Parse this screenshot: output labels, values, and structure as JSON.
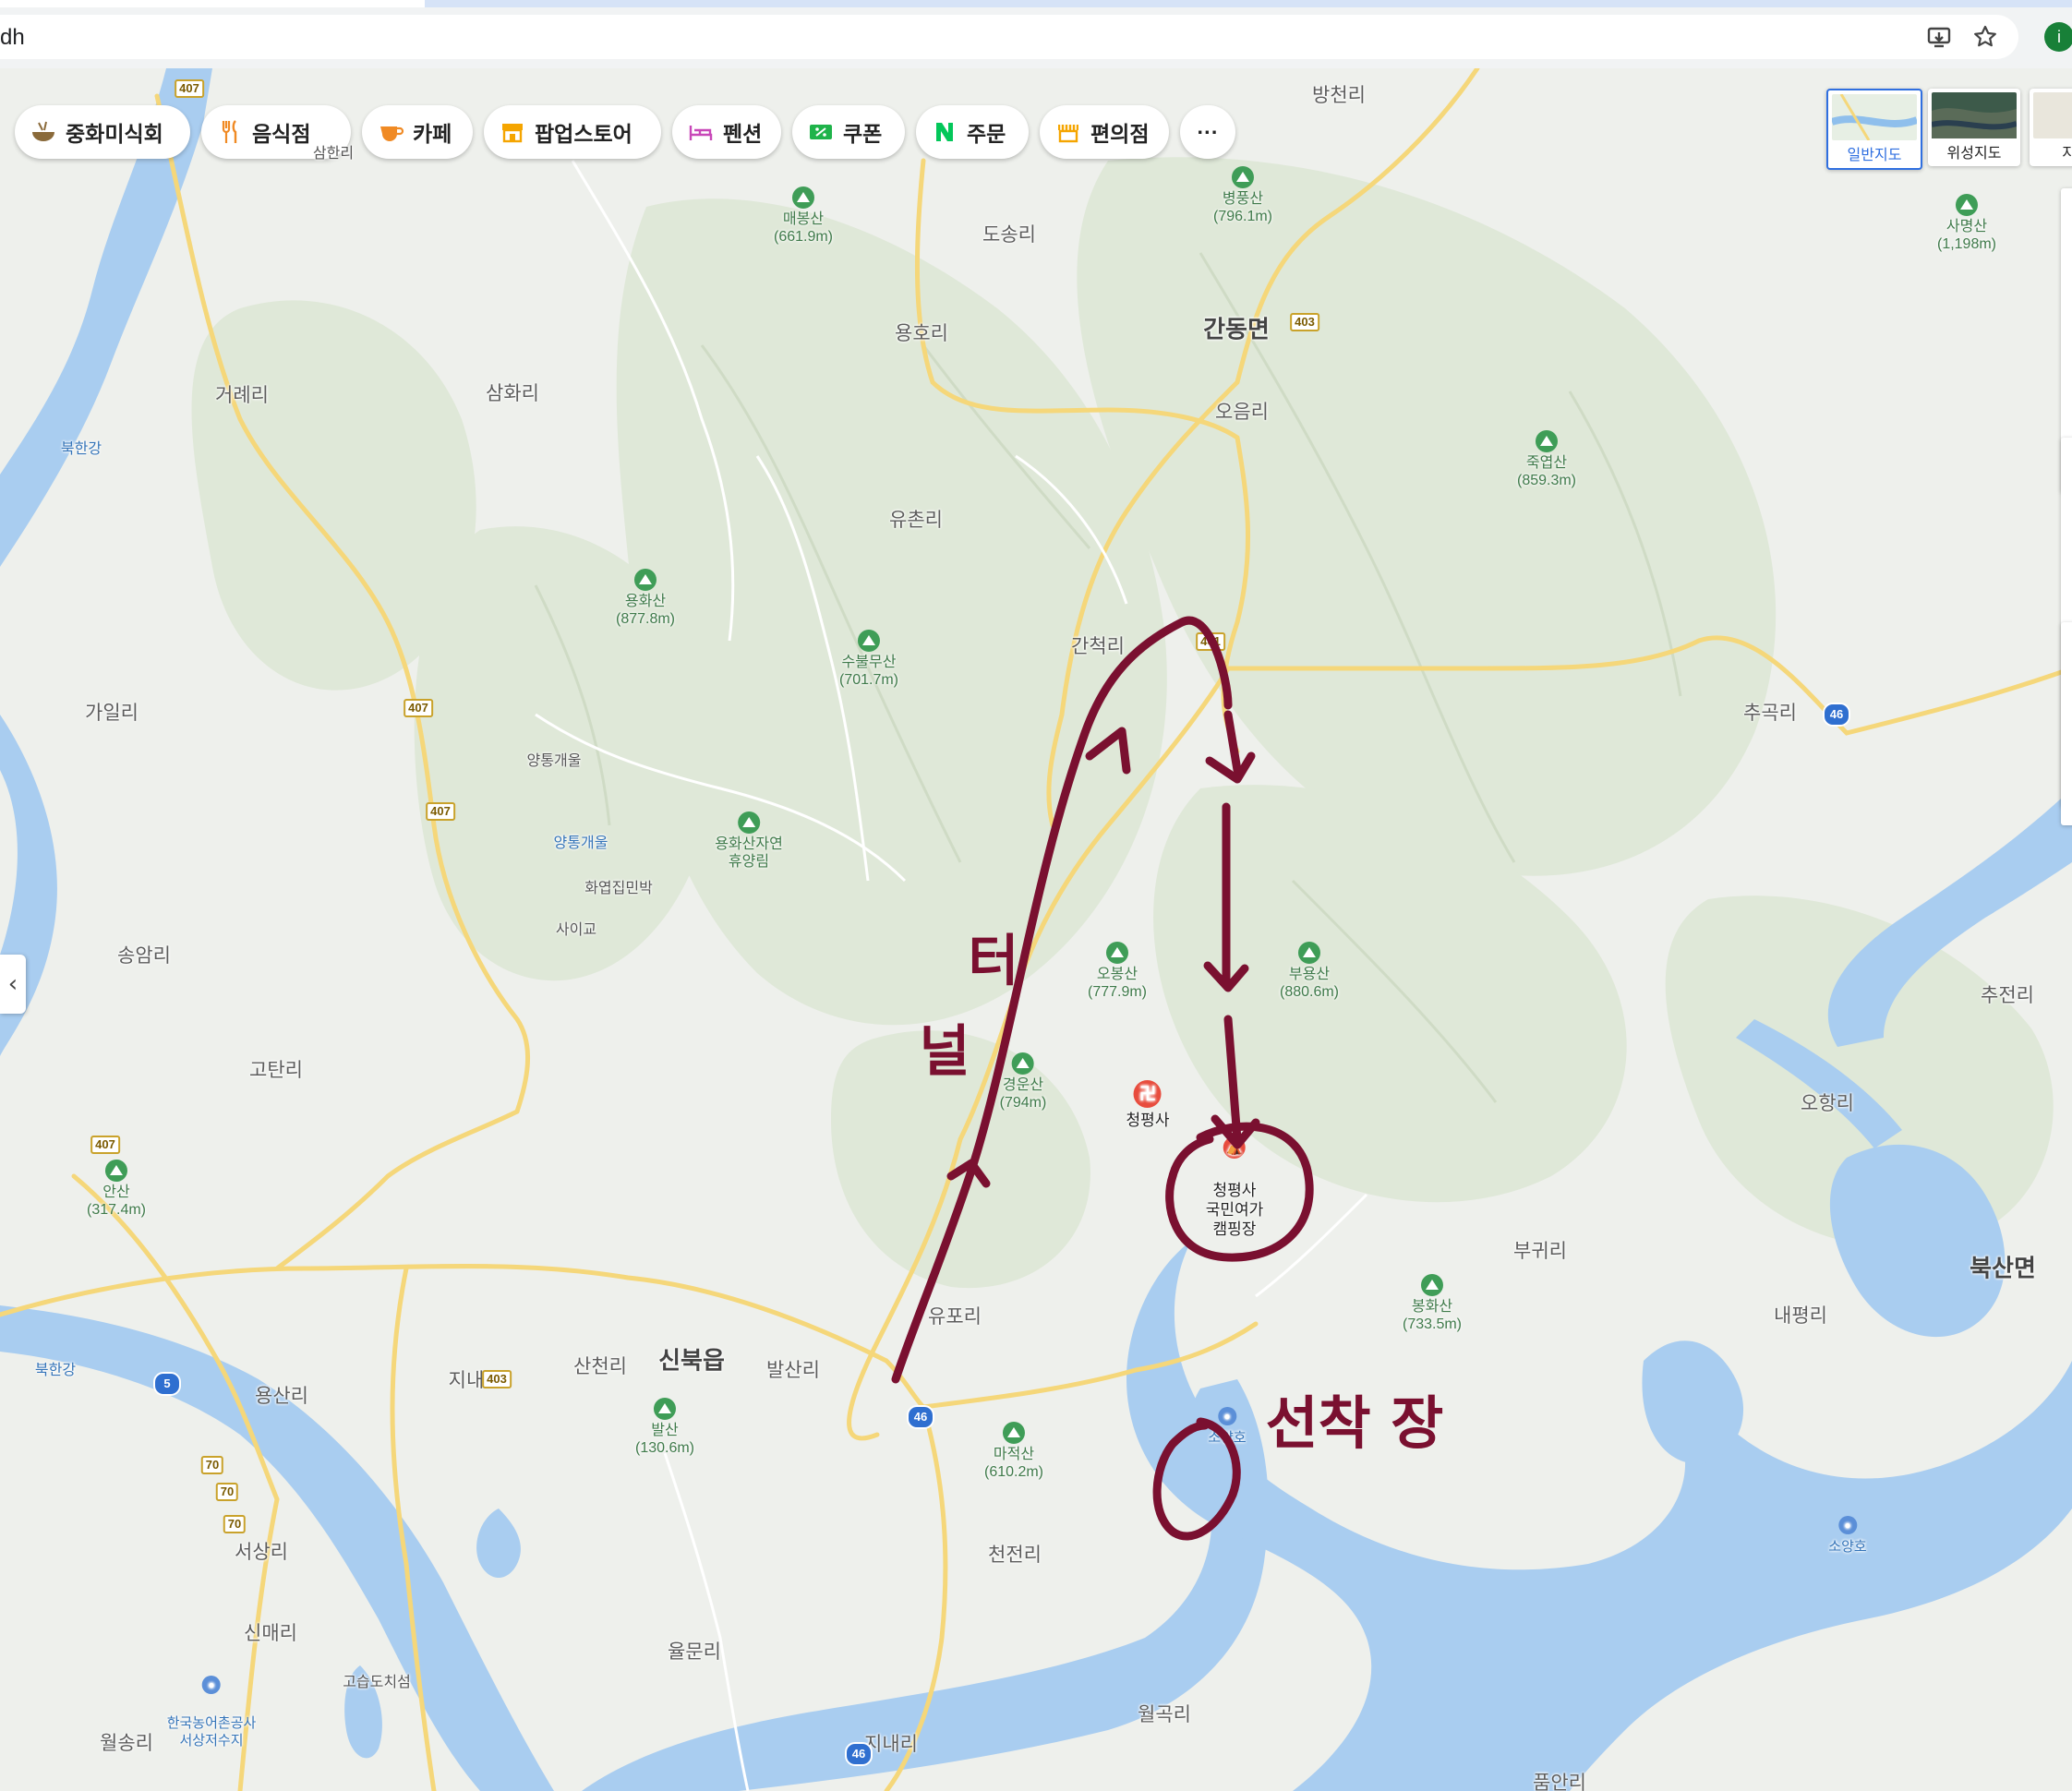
{
  "browser": {
    "url_text": "dh",
    "profile_initial": "i",
    "icons": [
      "install-app-icon",
      "bookmark-star-icon"
    ]
  },
  "categories": [
    {
      "label": "중화미식회",
      "icon": "bowl-icon",
      "color": "#8a6a3a"
    },
    {
      "label": "음식점",
      "icon": "fork-knife-icon",
      "color": "#f08a24"
    },
    {
      "label": "카페",
      "icon": "coffee-cup-icon",
      "color": "#f08a24"
    },
    {
      "label": "팝업스토어",
      "icon": "store-icon",
      "color": "#f5a500"
    },
    {
      "label": "펜션",
      "icon": "bed-icon",
      "color": "#c847b8"
    },
    {
      "label": "쿠폰",
      "icon": "coupon-icon",
      "color": "#1fb34a"
    },
    {
      "label": "주문",
      "icon": "naver-n-icon",
      "color": "#03c75a"
    },
    {
      "label": "편의점",
      "icon": "convenience-store-icon",
      "color": "#f5a500"
    },
    {
      "label": "···",
      "icon": "more-icon",
      "color": "#222222"
    }
  ],
  "map_types": [
    {
      "label": "일반지도",
      "active": true
    },
    {
      "label": "위성지도",
      "active": false
    },
    {
      "label": "지형",
      "active": false
    }
  ],
  "colors": {
    "water": "#a9cdf0",
    "road_yellow": "#f5d77a",
    "green_terrain": "#dbe6d2",
    "ink": "#7a1030"
  },
  "places": {
    "village": [
      "방천리",
      "도송리",
      "용호리",
      "오음리",
      "거례리",
      "삼화리",
      "유촌리",
      "간척리",
      "가일리",
      "추곡리",
      "송암리",
      "고탄리",
      "추전리",
      "오항리",
      "부귀리",
      "내평리",
      "용산리",
      "지내",
      "산천리",
      "발산리",
      "유포리",
      "서상리",
      "천전리",
      "신매리",
      "율문리",
      "월곡리",
      "월송리",
      "지내리",
      "품안리"
    ],
    "town": [
      "간동면",
      "신북읍",
      "북산면"
    ],
    "small": [
      "양통개울",
      "화엽집민박",
      "사이교",
      "고습도치섬",
      "삼한리"
    ],
    "water": [
      "북한강",
      "양통개울"
    ]
  },
  "mountains": [
    {
      "name": "매봉산",
      "height": "(661.9m)"
    },
    {
      "name": "병풍산",
      "height": "(796.1m)"
    },
    {
      "name": "사명산",
      "height": "(1,198m)"
    },
    {
      "name": "죽엽산",
      "height": "(859.3m)"
    },
    {
      "name": "용화산",
      "height": "(877.8m)"
    },
    {
      "name": "수불무산",
      "height": "(701.7m)"
    },
    {
      "name": "용화산자연",
      "height": "휴양림"
    },
    {
      "name": "오봉산",
      "height": "(777.9m)"
    },
    {
      "name": "부용산",
      "height": "(880.6m)"
    },
    {
      "name": "경운산",
      "height": "(794m)"
    },
    {
      "name": "안산",
      "height": "(317.4m)"
    },
    {
      "name": "봉화산",
      "height": "(733.5m)"
    },
    {
      "name": "발산",
      "height": "(130.6m)"
    },
    {
      "name": "마적산",
      "height": "(610.2m)"
    }
  ],
  "route_shields": [
    "407",
    "403",
    "407",
    "407",
    "407",
    "461",
    "403",
    "70",
    "70",
    "70"
  ],
  "highway_shields": [
    "46",
    "5",
    "46",
    "46"
  ],
  "pois": [
    {
      "name": "청평사",
      "type": "temple"
    },
    {
      "name": "청평사\n국민여가\n캠핑장",
      "type": "camping"
    },
    {
      "name": "소양호",
      "type": "water"
    },
    {
      "name": "소양호",
      "type": "water"
    },
    {
      "name": "한국농어촌공사\n서상저수지",
      "type": "water"
    }
  ],
  "annotations": {
    "tunnel_text": [
      "터",
      "널"
    ],
    "marker_text": "선착 장"
  }
}
